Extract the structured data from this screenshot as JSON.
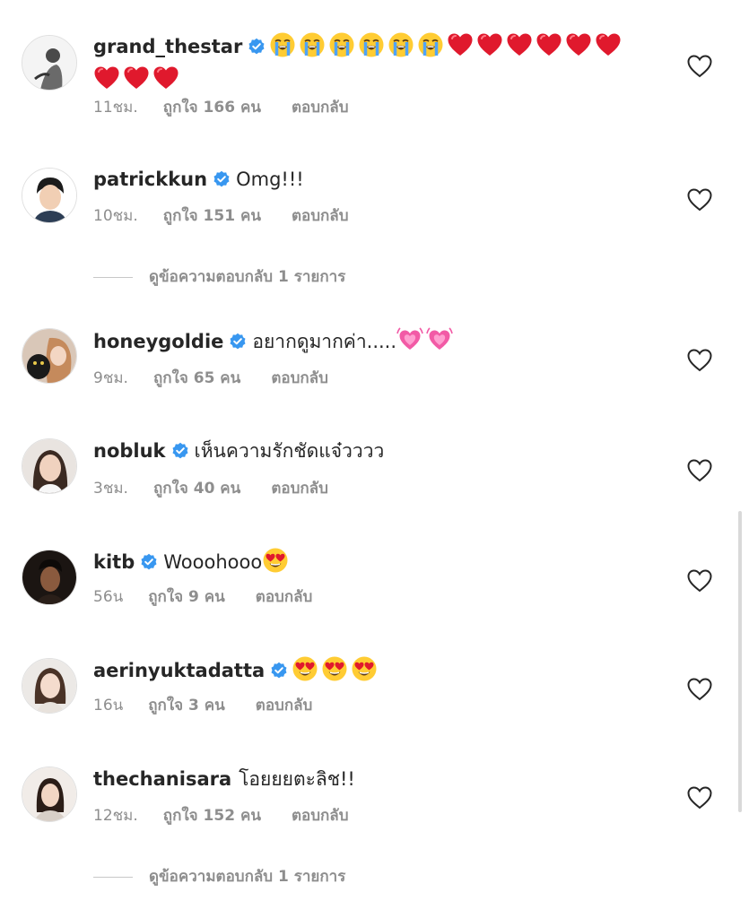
{
  "comments": [
    {
      "username": "grand_thestar",
      "verified": true,
      "text": "",
      "emojis_line1": [
        "loudly-crying-face",
        "loudly-crying-face",
        "loudly-crying-face",
        "loudly-crying-face",
        "loudly-crying-face",
        "loudly-crying-face",
        "red-heart",
        "red-heart",
        "red-heart",
        "red-heart",
        "red-heart",
        "red-heart"
      ],
      "emojis_line2": [
        "red-heart",
        "red-heart",
        "red-heart"
      ],
      "time": "11ชม.",
      "likes": "ถูกใจ 166 คน",
      "reply": "ตอบกลับ"
    },
    {
      "username": "patrickkun",
      "verified": true,
      "text": "Omg!!!",
      "time": "10ชม.",
      "likes": "ถูกใจ 151 คน",
      "reply": "ตอบกลับ"
    },
    {
      "username": "honeygoldie",
      "verified": true,
      "text": "อยากดูมากค่า.....",
      "emojis": [
        "growing-heart",
        "growing-heart"
      ],
      "time": "9ชม.",
      "likes": "ถูกใจ 65 คน",
      "reply": "ตอบกลับ"
    },
    {
      "username": "nobluk",
      "verified": true,
      "text": "เห็นความรักชัดแจ๋วววว",
      "time": "3ชม.",
      "likes": "ถูกใจ 40 คน",
      "reply": "ตอบกลับ"
    },
    {
      "username": "kitb",
      "verified": true,
      "text": "Wooohooo",
      "emojis": [
        "heart-eyes-face"
      ],
      "time": "56น",
      "likes": "ถูกใจ 9 คน",
      "reply": "ตอบกลับ"
    },
    {
      "username": "aerinyuktadatta",
      "verified": true,
      "text": "",
      "emojis": [
        "heart-eyes-face",
        "heart-eyes-face",
        "heart-eyes-face"
      ],
      "time": "16น",
      "likes": "ถูกใจ 3 คน",
      "reply": "ตอบกลับ"
    },
    {
      "username": "thechanisara",
      "verified": false,
      "text": "โอยยยตะลิช!!",
      "time": "12ชม.",
      "likes": "ถูกใจ 152 คน",
      "reply": "ตอบกลับ"
    }
  ],
  "view_replies_label": "ดูข้อความตอบกลับ 1 รายการ",
  "colors": {
    "verified_badge": "#3897f0",
    "meta_gray": "#8e8e8e",
    "text": "#262626"
  },
  "icons": {
    "like": "heart-outline-icon",
    "verified": "verified-badge-icon"
  }
}
